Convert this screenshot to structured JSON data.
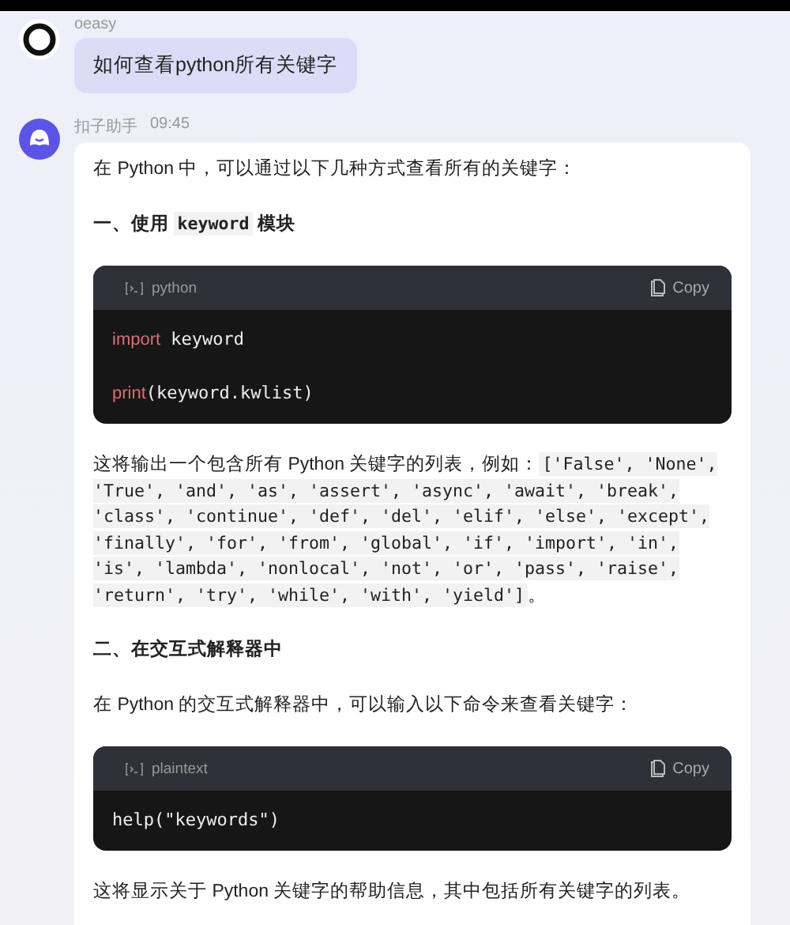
{
  "user_message": {
    "name": "oeasy",
    "text": "如何查看python所有关键字"
  },
  "assistant_message": {
    "name": "扣子助手",
    "time": "09:45",
    "blocks": [
      {
        "kind": "paragraph",
        "parts": [
          {
            "kind": "text",
            "text": "在 Python 中，可以通过以下几种方式查看所有的关键字："
          }
        ]
      },
      {
        "kind": "heading",
        "parts": [
          {
            "kind": "text",
            "text": "一、使用 "
          },
          {
            "kind": "code",
            "text": "keyword"
          },
          {
            "kind": "text",
            "text": " 模块"
          }
        ]
      },
      {
        "kind": "code_block",
        "language": "python",
        "copy_label": "Copy",
        "lines": [
          {
            "kind": "code",
            "tokens": [
              {
                "kind": "keyword",
                "text": "import"
              },
              {
                "kind": "plain",
                "text": " keyword"
              }
            ]
          },
          {
            "kind": "blank"
          },
          {
            "kind": "code",
            "tokens": [
              {
                "kind": "keyword",
                "text": "print"
              },
              {
                "kind": "plain",
                "text": "(keyword.kwlist)"
              }
            ]
          }
        ]
      },
      {
        "kind": "paragraph",
        "parts": [
          {
            "kind": "text",
            "text": "这将输出一个包含所有 Python 关键字的列表，例如："
          },
          {
            "kind": "code",
            "text": "['False', 'None', 'True', 'and', 'as', 'assert', 'async', 'await', 'break', 'class', 'continue', 'def', 'del', 'elif', 'else', 'except', 'finally', 'for', 'from', 'global', 'if', 'import', 'in', 'is', 'lambda', 'nonlocal', 'not', 'or', 'pass', 'raise', 'return', 'try', 'while', 'with', 'yield']"
          },
          {
            "kind": "text",
            "text": "。"
          }
        ]
      },
      {
        "kind": "heading",
        "parts": [
          {
            "kind": "text",
            "text": "二、在交互式解释器中"
          }
        ]
      },
      {
        "kind": "paragraph",
        "parts": [
          {
            "kind": "text",
            "text": "在 Python 的交互式解释器中，可以输入以下命令来查看关键字："
          }
        ]
      },
      {
        "kind": "code_block",
        "language": "plaintext",
        "copy_label": "Copy",
        "lines": [
          {
            "kind": "code",
            "tokens": [
              {
                "kind": "plain",
                "text": "help(\"keywords\")"
              }
            ]
          }
        ]
      },
      {
        "kind": "paragraph",
        "parts": [
          {
            "kind": "text",
            "text": "这将显示关于 Python 关键字的帮助信息，其中包括所有关键字的列表。"
          }
        ]
      }
    ]
  }
}
